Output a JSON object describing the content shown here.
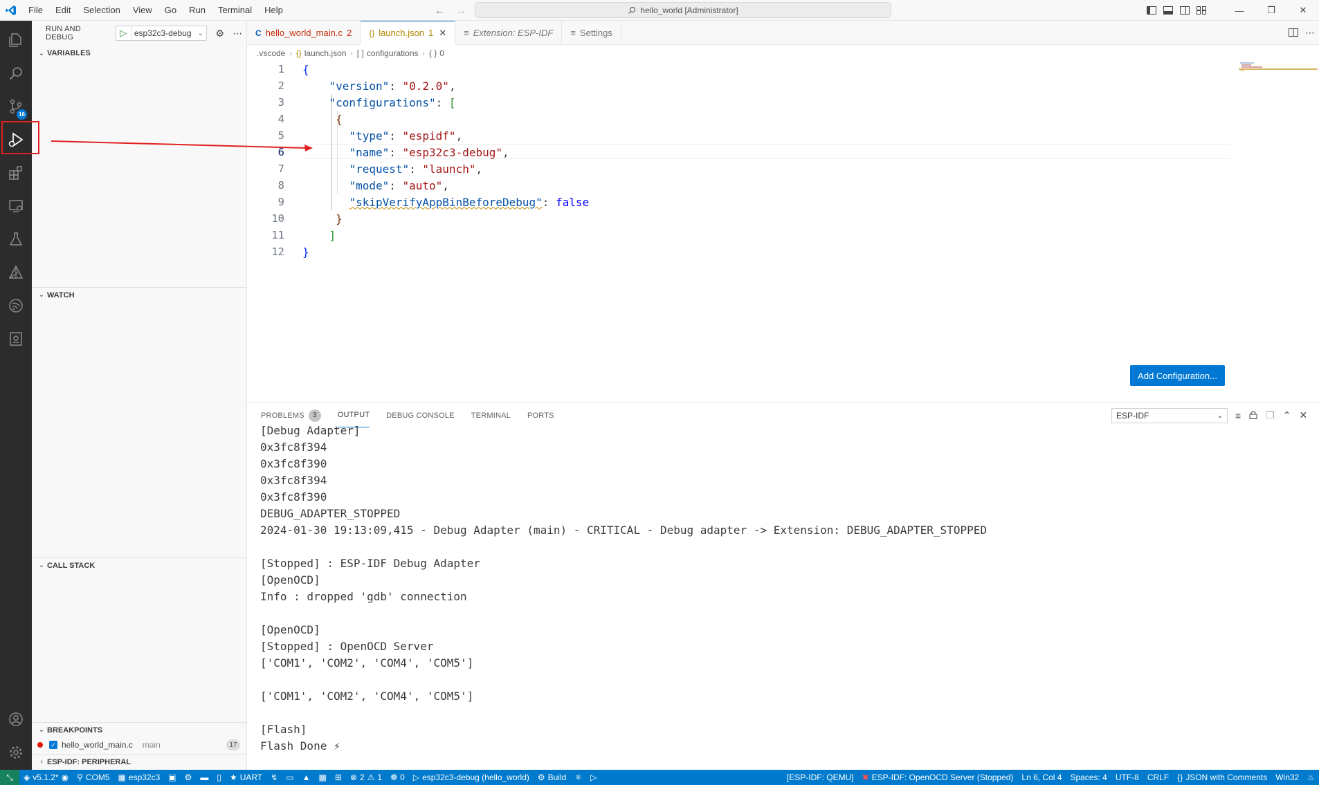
{
  "window": {
    "title": "hello_world [Administrator]"
  },
  "menu": [
    "File",
    "Edit",
    "Selection",
    "View",
    "Go",
    "Run",
    "Terminal",
    "Help"
  ],
  "sidebar": {
    "title": "RUN AND DEBUG",
    "config": "esp32c3-debug",
    "sections": {
      "variables": "VARIABLES",
      "watch": "WATCH",
      "call_stack": "CALL STACK",
      "breakpoints": "BREAKPOINTS",
      "peripheral": "ESP-IDF: PERIPHERAL"
    },
    "breakpoint": {
      "file": "hello_world_main.c",
      "function": "main",
      "count": "17"
    }
  },
  "activity": {
    "source_control_badge": "16"
  },
  "tabs": [
    {
      "label": "hello_world_main.c",
      "mod": "2"
    },
    {
      "label": "launch.json",
      "mod": "1"
    },
    {
      "label": "Extension: ESP-IDF"
    },
    {
      "label": "Settings"
    }
  ],
  "breadcrumb": [
    ".vscode",
    "launch.json",
    "configurations",
    "0"
  ],
  "editor": {
    "lines": [
      {
        "n": "1"
      },
      {
        "n": "2"
      },
      {
        "n": "3"
      },
      {
        "n": "4"
      },
      {
        "n": "5"
      },
      {
        "n": "6"
      },
      {
        "n": "7"
      },
      {
        "n": "8"
      },
      {
        "n": "9"
      },
      {
        "n": "10"
      },
      {
        "n": "11"
      },
      {
        "n": "12"
      }
    ],
    "code": {
      "version_key": "\"version\"",
      "version_val": "\"0.2.0\"",
      "configurations_key": "\"configurations\"",
      "type_key": "\"type\"",
      "type_val": "\"espidf\"",
      "name_key": "\"name\"",
      "name_val": "\"esp32c3-debug\"",
      "request_key": "\"request\"",
      "request_val": "\"launch\"",
      "mode_key": "\"mode\"",
      "mode_val": "\"auto\"",
      "skip_key": "\"skipVerifyAppBinBeforeDebug\"",
      "skip_val": "false"
    },
    "add_configuration": "Add Configuration..."
  },
  "panel": {
    "tabs": {
      "problems": "PROBLEMS",
      "problems_count": "3",
      "output": "OUTPUT",
      "debug_console": "DEBUG CONSOLE",
      "terminal": "TERMINAL",
      "ports": "PORTS"
    },
    "channel": "ESP-IDF",
    "output_lines": [
      "[Debug Adapter]",
      "0x3fc8f394",
      "0x3fc8f390",
      "0x3fc8f394",
      "0x3fc8f390",
      "DEBUG_ADAPTER_STOPPED",
      "2024-01-30 19:13:09,415 - Debug Adapter (main) - CRITICAL - Debug adapter -> Extension: DEBUG_ADAPTER_STOPPED",
      "",
      "[Stopped] : ESP-IDF Debug Adapter",
      "[OpenOCD]",
      "Info : dropped 'gdb' connection",
      "",
      "[OpenOCD]",
      "[Stopped] : OpenOCD Server",
      "['COM1', 'COM2', 'COM4', 'COM5']",
      "",
      "['COM1', 'COM2', 'COM4', 'COM5']",
      "",
      "[Flash]",
      "Flash Done ⚡"
    ]
  },
  "status": {
    "idf_version": "v5.1.2*",
    "port": "COM5",
    "target": "esp32c3",
    "flash_type": "UART",
    "errors": "2",
    "warnings": "1",
    "ports_count": "0",
    "debug_config": "esp32c3-debug (hello_world)",
    "build": "Build",
    "qemu": "[ESP-IDF: QEMU]",
    "openocd": "ESP-IDF: OpenOCD Server (Stopped)",
    "position": "Ln 6, Col 4",
    "spaces": "Spaces: 4",
    "encoding": "UTF-8",
    "eol": "CRLF",
    "language": "JSON with Comments",
    "platform": "Win32"
  },
  "colors": {
    "accent": "#0078d4",
    "statusbar": "#007acc",
    "activitybar": "#2c2c2c",
    "annotation": "#e02020"
  }
}
